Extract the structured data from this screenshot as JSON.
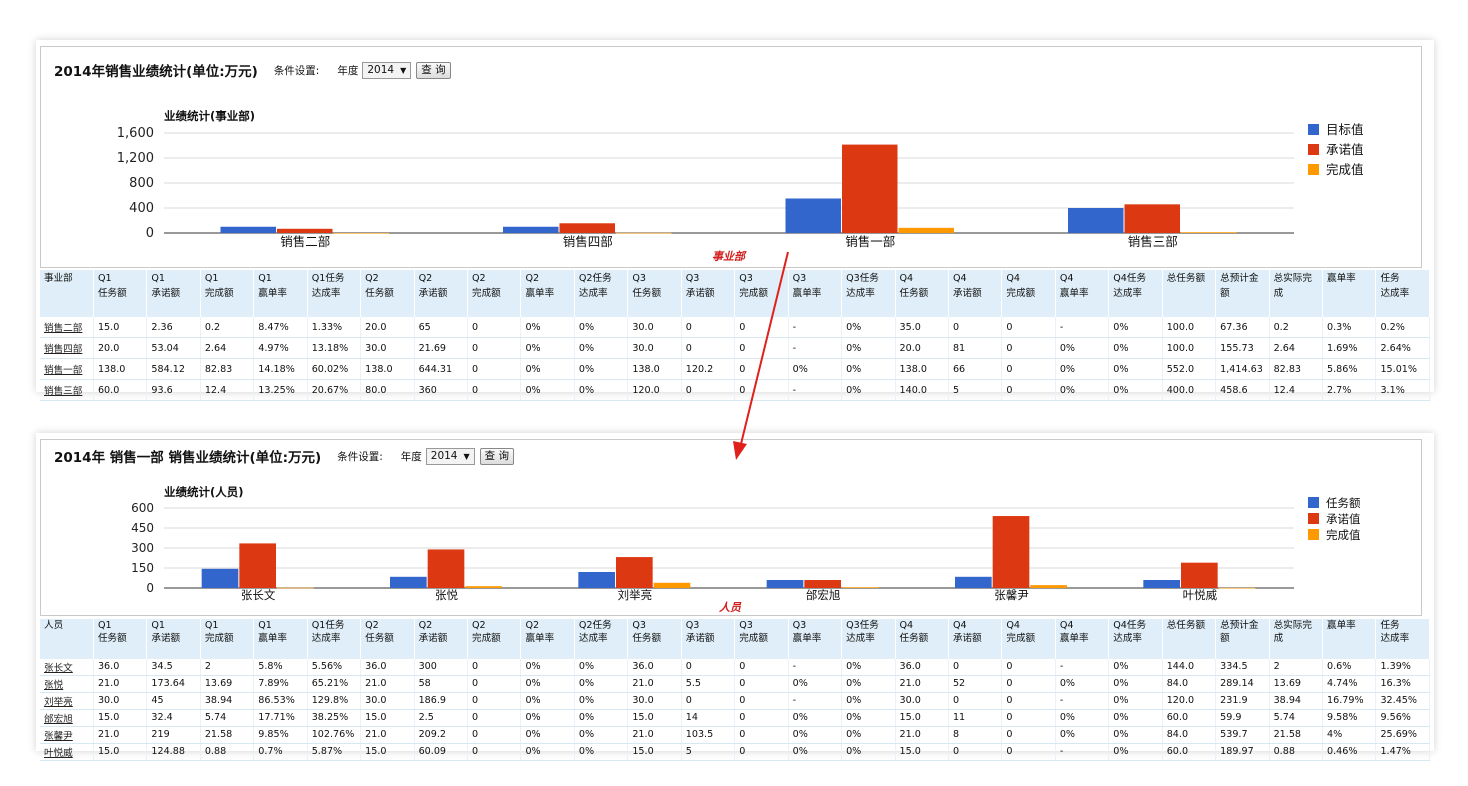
{
  "panels": [
    {
      "title": "2014年销售业绩统计(单位:万元)",
      "condition_label": "条件设置:",
      "year_label": "年度",
      "year_value": "2014",
      "query_button": "查 询",
      "section_label": "事业部",
      "chart_data": {
        "type": "bar",
        "title": "业绩统计(事业部)",
        "categories": [
          "销售二部",
          "销售四部",
          "销售一部",
          "销售三部"
        ],
        "series": [
          {
            "name": "目标值",
            "color": "#3366cc",
            "values": [
              100,
              100,
              552,
              400
            ]
          },
          {
            "name": "承诺值",
            "color": "#dc3912",
            "values": [
              67.36,
              155.73,
              1414.63,
              458.6
            ]
          },
          {
            "name": "完成值",
            "color": "#ff9900",
            "values": [
              0.2,
              2.64,
              82.83,
              12.4
            ]
          }
        ],
        "ylim": [
          0,
          1600
        ],
        "yticks": [
          "0",
          "400",
          "800",
          "1,200",
          "1,600"
        ],
        "legend_position": "right",
        "grid": true
      },
      "table": {
        "headers": [
          [
            "事业部",
            ""
          ],
          [
            "Q1",
            "任务额"
          ],
          [
            "Q1",
            "承诺额"
          ],
          [
            "Q1",
            "完成额"
          ],
          [
            "Q1",
            "赢单率"
          ],
          [
            "Q1任务",
            "达成率"
          ],
          [
            "Q2",
            "任务额"
          ],
          [
            "Q2",
            "承诺额"
          ],
          [
            "Q2",
            "完成额"
          ],
          [
            "Q2",
            "赢单率"
          ],
          [
            "Q2任务",
            "达成率"
          ],
          [
            "Q3",
            "任务额"
          ],
          [
            "Q3",
            "承诺额"
          ],
          [
            "Q3",
            "完成额"
          ],
          [
            "Q3",
            "赢单率"
          ],
          [
            "Q3任务",
            "达成率"
          ],
          [
            "Q4",
            "任务额"
          ],
          [
            "Q4",
            "承诺额"
          ],
          [
            "Q4",
            "完成额"
          ],
          [
            "Q4",
            "赢单率"
          ],
          [
            "Q4任务",
            "达成率"
          ],
          [
            "总任务额",
            ""
          ],
          [
            "总预计金额",
            ""
          ],
          [
            "总实际完成",
            ""
          ],
          [
            "赢单率",
            ""
          ],
          [
            "任务",
            "达成率"
          ]
        ],
        "rows": [
          [
            "销售二部",
            "15.0",
            "2.36",
            "0.2",
            "8.47%",
            "1.33%",
            "20.0",
            "65",
            "0",
            "0%",
            "0%",
            "30.0",
            "0",
            "0",
            "-",
            "0%",
            "35.0",
            "0",
            "0",
            "-",
            "0%",
            "100.0",
            "67.36",
            "0.2",
            "0.3%",
            "0.2%"
          ],
          [
            "销售四部",
            "20.0",
            "53.04",
            "2.64",
            "4.97%",
            "13.18%",
            "30.0",
            "21.69",
            "0",
            "0%",
            "0%",
            "30.0",
            "0",
            "0",
            "-",
            "0%",
            "20.0",
            "81",
            "0",
            "0%",
            "0%",
            "100.0",
            "155.73",
            "2.64",
            "1.69%",
            "2.64%"
          ],
          [
            "销售一部",
            "138.0",
            "584.12",
            "82.83",
            "14.18%",
            "60.02%",
            "138.0",
            "644.31",
            "0",
            "0%",
            "0%",
            "138.0",
            "120.2",
            "0",
            "0%",
            "0%",
            "138.0",
            "66",
            "0",
            "0%",
            "0%",
            "552.0",
            "1,414.63",
            "82.83",
            "5.86%",
            "15.01%"
          ],
          [
            "销售三部",
            "60.0",
            "93.6",
            "12.4",
            "13.25%",
            "20.67%",
            "80.0",
            "360",
            "0",
            "0%",
            "0%",
            "120.0",
            "0",
            "0",
            "-",
            "0%",
            "140.0",
            "5",
            "0",
            "0%",
            "0%",
            "400.0",
            "458.6",
            "12.4",
            "2.7%",
            "3.1%"
          ]
        ]
      }
    },
    {
      "title": "2014年 销售一部 销售业绩统计(单位:万元)",
      "condition_label": "条件设置:",
      "year_label": "年度",
      "year_value": "2014",
      "query_button": "查 询",
      "section_label": "人员",
      "chart_data": {
        "type": "bar",
        "title": "业绩统计(人员)",
        "categories": [
          "张长文",
          "张悦",
          "刘举亮",
          "邰宏旭",
          "张馨尹",
          "叶悦威"
        ],
        "series": [
          {
            "name": "任务额",
            "color": "#3366cc",
            "values": [
              144,
              84,
              120,
              60,
              84,
              60
            ]
          },
          {
            "name": "承诺值",
            "color": "#dc3912",
            "values": [
              334.5,
              289.14,
              231.9,
              59.9,
              539.7,
              189.97
            ]
          },
          {
            "name": "完成值",
            "color": "#ff9900",
            "values": [
              2,
              13.69,
              38.94,
              5.74,
              21.58,
              0.88
            ]
          }
        ],
        "ylim": [
          0,
          600
        ],
        "yticks": [
          "0",
          "150",
          "300",
          "450",
          "600"
        ],
        "legend_position": "right",
        "grid": true
      },
      "table": {
        "headers": [
          [
            "人员",
            ""
          ],
          [
            "Q1",
            "任务额"
          ],
          [
            "Q1",
            "承诺额"
          ],
          [
            "Q1",
            "完成额"
          ],
          [
            "Q1",
            "赢单率"
          ],
          [
            "Q1任务",
            "达成率"
          ],
          [
            "Q2",
            "任务额"
          ],
          [
            "Q2",
            "承诺额"
          ],
          [
            "Q2",
            "完成额"
          ],
          [
            "Q2",
            "赢单率"
          ],
          [
            "Q2任务",
            "达成率"
          ],
          [
            "Q3",
            "任务额"
          ],
          [
            "Q3",
            "承诺额"
          ],
          [
            "Q3",
            "完成额"
          ],
          [
            "Q3",
            "赢单率"
          ],
          [
            "Q3任务",
            "达成率"
          ],
          [
            "Q4",
            "任务额"
          ],
          [
            "Q4",
            "承诺额"
          ],
          [
            "Q4",
            "完成额"
          ],
          [
            "Q4",
            "赢单率"
          ],
          [
            "Q4任务",
            "达成率"
          ],
          [
            "总任务额",
            ""
          ],
          [
            "总预计金额",
            ""
          ],
          [
            "总实际完成",
            ""
          ],
          [
            "赢单率",
            ""
          ],
          [
            "任务",
            "达成率"
          ]
        ],
        "rows": [
          [
            "张长文",
            "36.0",
            "34.5",
            "2",
            "5.8%",
            "5.56%",
            "36.0",
            "300",
            "0",
            "0%",
            "0%",
            "36.0",
            "0",
            "0",
            "-",
            "0%",
            "36.0",
            "0",
            "0",
            "-",
            "0%",
            "144.0",
            "334.5",
            "2",
            "0.6%",
            "1.39%"
          ],
          [
            "张悦",
            "21.0",
            "173.64",
            "13.69",
            "7.89%",
            "65.21%",
            "21.0",
            "58",
            "0",
            "0%",
            "0%",
            "21.0",
            "5.5",
            "0",
            "0%",
            "0%",
            "21.0",
            "52",
            "0",
            "0%",
            "0%",
            "84.0",
            "289.14",
            "13.69",
            "4.74%",
            "16.3%"
          ],
          [
            "刘举亮",
            "30.0",
            "45",
            "38.94",
            "86.53%",
            "129.8%",
            "30.0",
            "186.9",
            "0",
            "0%",
            "0%",
            "30.0",
            "0",
            "0",
            "-",
            "0%",
            "30.0",
            "0",
            "0",
            "-",
            "0%",
            "120.0",
            "231.9",
            "38.94",
            "16.79%",
            "32.45%"
          ],
          [
            "邰宏旭",
            "15.0",
            "32.4",
            "5.74",
            "17.71%",
            "38.25%",
            "15.0",
            "2.5",
            "0",
            "0%",
            "0%",
            "15.0",
            "14",
            "0",
            "0%",
            "0%",
            "15.0",
            "11",
            "0",
            "0%",
            "0%",
            "60.0",
            "59.9",
            "5.74",
            "9.58%",
            "9.56%"
          ],
          [
            "张馨尹",
            "21.0",
            "219",
            "21.58",
            "9.85%",
            "102.76%",
            "21.0",
            "209.2",
            "0",
            "0%",
            "0%",
            "21.0",
            "103.5",
            "0",
            "0%",
            "0%",
            "21.0",
            "8",
            "0",
            "0%",
            "0%",
            "84.0",
            "539.7",
            "21.58",
            "4%",
            "25.69%"
          ],
          [
            "叶悦威",
            "15.0",
            "124.88",
            "0.88",
            "0.7%",
            "5.87%",
            "15.0",
            "60.09",
            "0",
            "0%",
            "0%",
            "15.0",
            "5",
            "0",
            "0%",
            "0%",
            "15.0",
            "0",
            "0",
            "-",
            "0%",
            "60.0",
            "189.97",
            "0.88",
            "0.46%",
            "1.47%"
          ]
        ]
      }
    }
  ]
}
